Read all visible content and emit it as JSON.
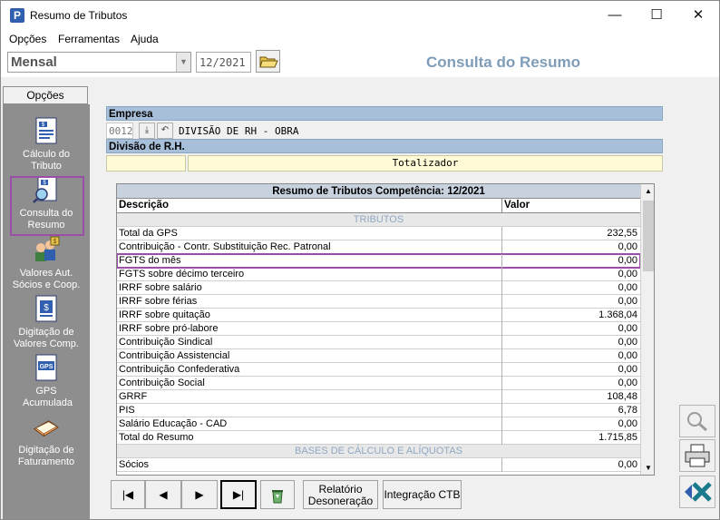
{
  "window": {
    "title": "Resumo de Tributos",
    "minimize": "—",
    "maximize": "☐",
    "close": "✕"
  },
  "menu": {
    "items": [
      {
        "label": "Opções"
      },
      {
        "label": "Ferramentas"
      },
      {
        "label": "Ajuda"
      }
    ]
  },
  "toolbar": {
    "period_type": "Mensal",
    "competence": "12/2021",
    "open_icon": "folder-open-icon",
    "title": "Consulta do Resumo"
  },
  "sidebar": {
    "header": "Opções",
    "items": [
      {
        "label": "Cálculo do Tributo",
        "icon": "calculator-doc-icon"
      },
      {
        "label": "Consulta do Resumo",
        "icon": "search-doc-icon"
      },
      {
        "label": "Valores Aut. Sócios e Coop.",
        "icon": "people-money-icon"
      },
      {
        "label": "Digitação de Valores Comp.",
        "icon": "edit-doc-icon"
      },
      {
        "label": "GPS Acumulada",
        "icon": "gps-doc-icon"
      },
      {
        "label": "Digitação de Faturamento",
        "icon": "book-icon"
      }
    ]
  },
  "company": {
    "label": "Empresa",
    "code": "0012",
    "name": "DIVISÃO DE RH - OBRA",
    "division_label": "Divisão de R.H.",
    "totalizer": "Totalizador"
  },
  "grid": {
    "title": "Resumo de Tributos Competência: 12/2021",
    "col_desc": "Descrição",
    "col_value": "Valor",
    "section_tributos": "TRIBUTOS",
    "rows": [
      {
        "desc": "Total da GPS",
        "value": "232,55"
      },
      {
        "desc": "Contribuição - Contr. Substituição Rec. Patronal",
        "value": "0,00"
      },
      {
        "desc": "FGTS do mês",
        "value": "0,00"
      },
      {
        "desc": "FGTS sobre décimo terceiro",
        "value": "0,00"
      },
      {
        "desc": "IRRF sobre salário",
        "value": "0,00"
      },
      {
        "desc": "IRRF sobre férias",
        "value": "0,00"
      },
      {
        "desc": "IRRF sobre quitação",
        "value": "1.368,04"
      },
      {
        "desc": "IRRF sobre pró-labore",
        "value": "0,00"
      },
      {
        "desc": "Contribuição Sindical",
        "value": "0,00"
      },
      {
        "desc": "Contribuição Assistencial",
        "value": "0,00"
      },
      {
        "desc": "Contribuição Confederativa",
        "value": "0,00"
      },
      {
        "desc": "Contribuição Social",
        "value": "0,00"
      },
      {
        "desc": "GRRF",
        "value": "108,48"
      },
      {
        "desc": "PIS",
        "value": "6,78"
      },
      {
        "desc": "Salário Educação - CAD",
        "value": "0,00"
      },
      {
        "desc": "Total do Resumo",
        "value": "1.715,85"
      }
    ],
    "section_bases": "BASES DE CÁLCULO E ALÍQUOTAS",
    "rows2": [
      {
        "desc": "Sócios",
        "value": "0,00"
      }
    ],
    "highlight_color": "#9a4ea7"
  },
  "bottom": {
    "first": "|◀",
    "prev": "◀",
    "next": "▶",
    "last": "▶|",
    "relatorio": "Relatório",
    "desoneracao": "Desoneração",
    "integracao": "Integração CTB"
  }
}
